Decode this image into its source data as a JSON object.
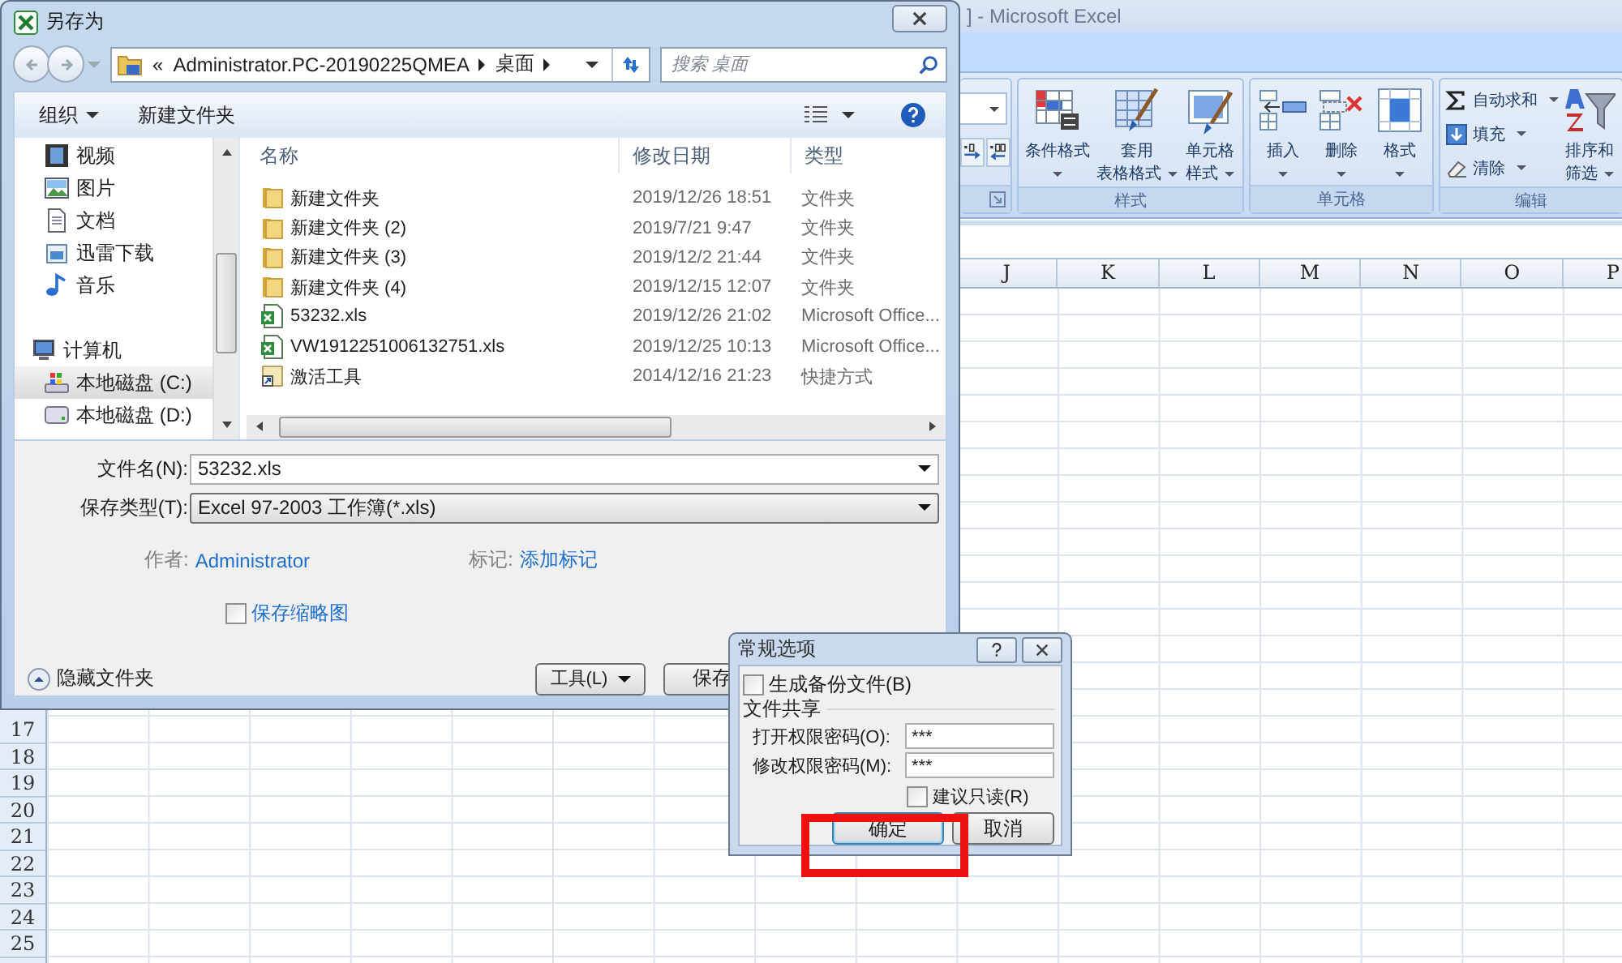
{
  "excel": {
    "title": "] - Microsoft Excel",
    "ribbon_groups": [
      {
        "label": "样式",
        "buttons": [
          {
            "kind": "cond",
            "lines": [
              "条件格式"
            ]
          },
          {
            "kind": "table",
            "lines": [
              "套用",
              "表格格式"
            ]
          },
          {
            "kind": "cellstyle",
            "lines": [
              "单元格",
              "样式"
            ]
          }
        ]
      },
      {
        "label": "单元格",
        "buttons": [
          {
            "kind": "insert",
            "lines": [
              "插入"
            ]
          },
          {
            "kind": "delete",
            "lines": [
              "删除"
            ]
          },
          {
            "kind": "format",
            "lines": [
              "格式"
            ]
          }
        ]
      },
      {
        "label": "编辑",
        "small": [
          {
            "kind": "sum",
            "label": "自动求和"
          },
          {
            "kind": "fill",
            "label": "填充"
          },
          {
            "kind": "clear",
            "label": "清除"
          }
        ],
        "buttons": [
          {
            "kind": "sort",
            "lines": [
              "排序和",
              "筛选"
            ]
          }
        ]
      }
    ],
    "columns": [
      "J",
      "K",
      "L",
      "M",
      "N",
      "O",
      "P"
    ],
    "rows": [
      "17",
      "18",
      "19",
      "20",
      "21",
      "22",
      "23",
      "24",
      "25"
    ]
  },
  "save_as": {
    "title": "另存为",
    "breadcrumb": {
      "overflow": "«",
      "parts": [
        "Administrator.PC-20190225QMEA",
        "桌面"
      ]
    },
    "search": {
      "placeholder": "搜索 桌面"
    },
    "toolbar": {
      "organize": "组织",
      "new_folder": "新建文件夹"
    },
    "nav": [
      {
        "label": "视频",
        "kind": "video",
        "selected": false
      },
      {
        "label": "图片",
        "kind": "picture",
        "selected": false
      },
      {
        "label": "文档",
        "kind": "document",
        "selected": false
      },
      {
        "label": "迅雷下载",
        "kind": "download",
        "selected": false
      },
      {
        "label": "音乐",
        "kind": "music",
        "selected": false
      },
      {
        "label": "计算机",
        "kind": "computer",
        "selected": false,
        "children": [
          {
            "label": "本地磁盘 (C:)",
            "kind": "system-drive",
            "selected": true
          },
          {
            "label": "本地磁盘 (D:)",
            "kind": "drive",
            "selected": false
          }
        ]
      }
    ],
    "columns": [
      "名称",
      "修改日期",
      "类型"
    ],
    "files": [
      {
        "kind": "folder",
        "name": "新建文件夹",
        "date": "2019/12/26 18:51",
        "type": "文件夹"
      },
      {
        "kind": "folder",
        "name": "新建文件夹 (2)",
        "date": "2019/7/21 9:47",
        "type": "文件夹"
      },
      {
        "kind": "folder",
        "name": "新建文件夹 (3)",
        "date": "2019/12/2 21:44",
        "type": "文件夹"
      },
      {
        "kind": "folder",
        "name": "新建文件夹 (4)",
        "date": "2019/12/15 12:07",
        "type": "文件夹"
      },
      {
        "kind": "xls",
        "name": "53232.xls",
        "date": "2019/12/26 21:02",
        "type": "Microsoft Office..."
      },
      {
        "kind": "xls",
        "name": "VW1912251006132751.xls",
        "date": "2019/12/25 10:13",
        "type": "Microsoft Office..."
      },
      {
        "kind": "shortcut",
        "name": "激活工具",
        "date": "2014/12/16 21:23",
        "type": "快捷方式"
      }
    ],
    "filename_label": "文件名(N):",
    "filename": "53232.xls",
    "filetype_label": "保存类型(T):",
    "filetype": "Excel 97-2003 工作簿(*.xls)",
    "author_label": "作者:",
    "author": "Administrator",
    "tags_label": "标记:",
    "tags": "添加标记",
    "thumbnail": {
      "label": "保存缩略图",
      "checked": false
    },
    "hide_folders": "隐藏文件夹",
    "tools": "工具(L)",
    "save": "保存"
  },
  "options": {
    "title": "常规选项",
    "backup": {
      "label": "生成备份文件(B)",
      "checked": false
    },
    "section": "文件共享",
    "fields": [
      {
        "label": "打开权限密码(O):",
        "value": "***"
      },
      {
        "label": "修改权限密码(M):",
        "value": "***"
      }
    ],
    "readonly": {
      "label": "建议只读(R)",
      "checked": false
    },
    "ok": "确定",
    "cancel": "取消"
  }
}
